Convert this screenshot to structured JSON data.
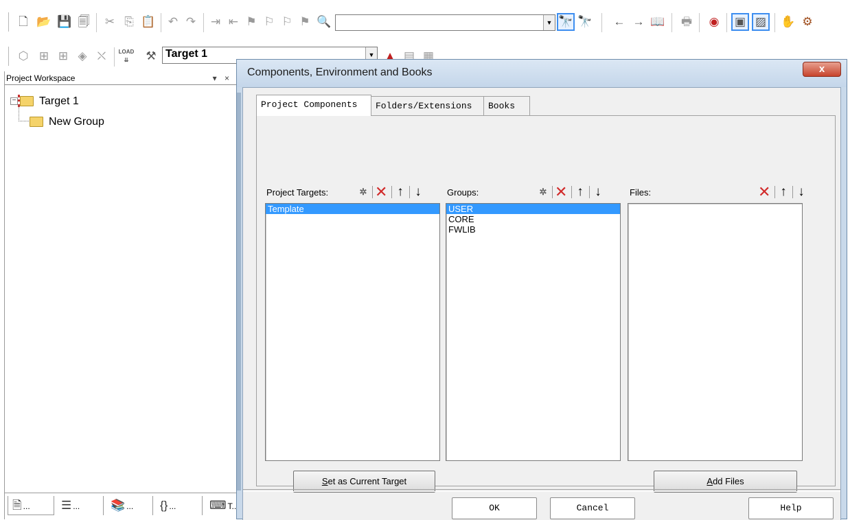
{
  "toolbar1": {
    "buttons": [
      "new-file",
      "open-file",
      "save",
      "save-all",
      "cut",
      "copy",
      "paste",
      "undo",
      "redo",
      "indent",
      "unindent",
      "bookmark-toggle",
      "bookmark-prev",
      "bookmark-next",
      "bookmark-clear",
      "find-in-files"
    ],
    "find_combo_value": "",
    "buttons_right": [
      "find",
      "incremental-find",
      "navigate-back",
      "navigate-forward",
      "bookmark-window",
      "print",
      "debug-session",
      "window-layout-1",
      "window-layout-2",
      "hand",
      "settings"
    ]
  },
  "toolbar2": {
    "target_combo_value": "Target 1",
    "load_label": "LOAD"
  },
  "workspace": {
    "title": "Project Workspace",
    "controls": "▾ ×",
    "tree": {
      "root": "Target 1",
      "child": "New Group"
    },
    "tabs": [
      "...",
      "...",
      "...",
      "...",
      "T..."
    ]
  },
  "dialog": {
    "title": "Components, Environment and Books",
    "close_label": "x",
    "tabs": [
      "Project Components",
      "Folders/Extensions",
      "Books"
    ],
    "selected_tab": "Project Components",
    "targets": {
      "header": "Project Targets:",
      "items": [
        "Template"
      ],
      "selected": "Template"
    },
    "groups": {
      "header": "Groups:",
      "items": [
        "USER",
        "CORE",
        "FWLIB"
      ],
      "selected": "USER"
    },
    "files": {
      "header": "Files:",
      "items": []
    },
    "set_target_button": {
      "prefix": "",
      "accel": "S",
      "rest": "et as Current Target"
    },
    "add_files_button": {
      "accel": "A",
      "rest": "dd Files"
    },
    "ok_label": "OK",
    "cancel_label": "Cancel",
    "help_label": "Help"
  },
  "colors": {
    "selection": "#3399ff",
    "delete_icon": "#d12a2a",
    "dialog_frame": "#c9d9ea",
    "close_button": "#c7442d"
  }
}
